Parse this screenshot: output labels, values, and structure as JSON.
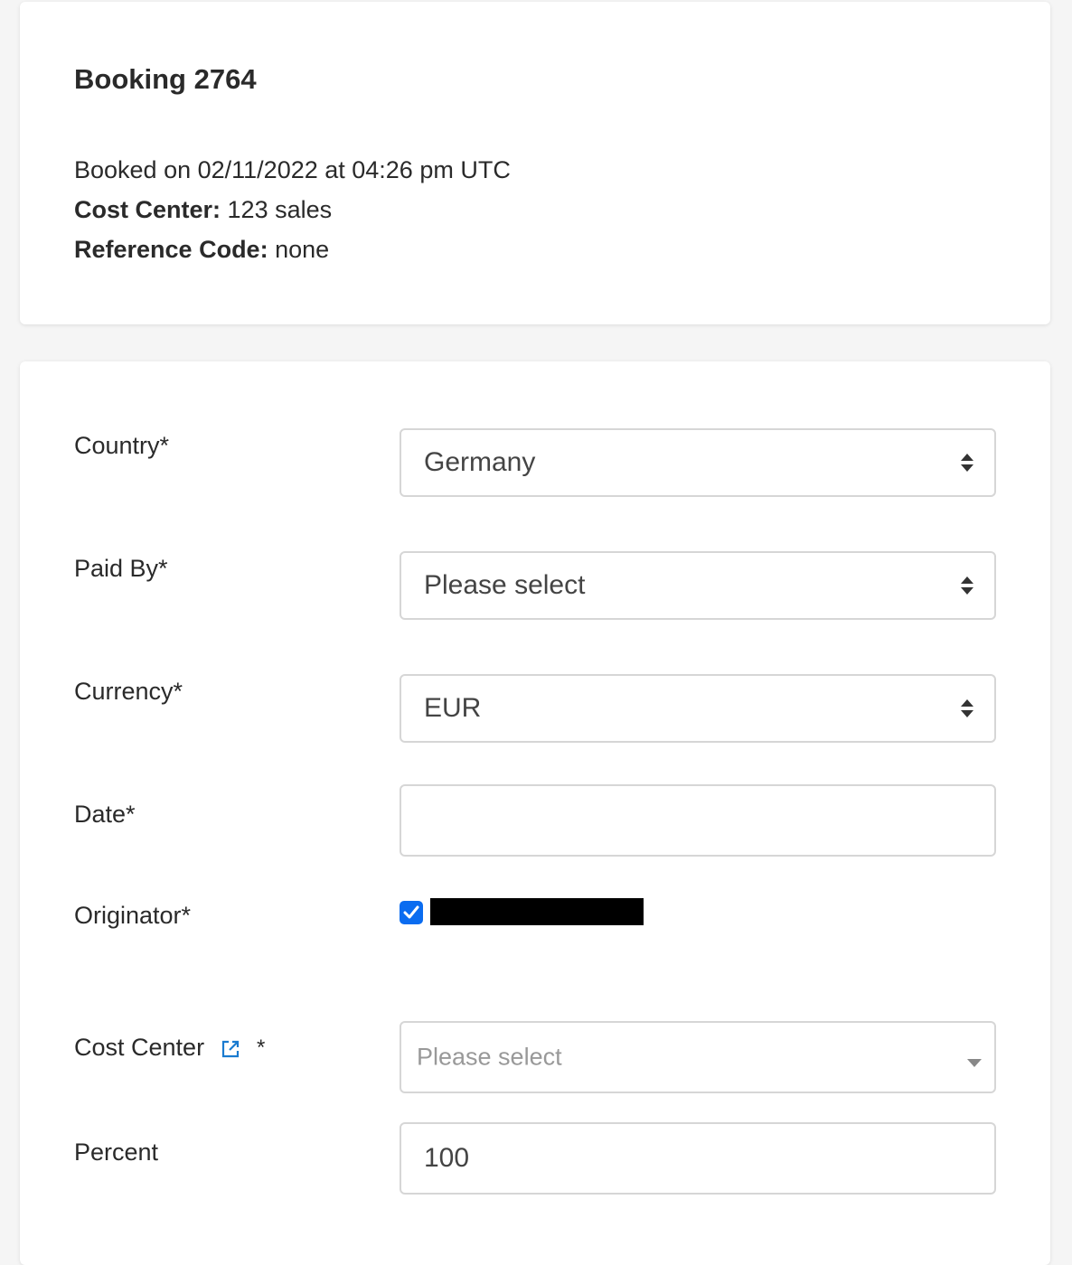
{
  "booking": {
    "title": "Booking 2764",
    "booked_on": "Booked on 02/11/2022 at 04:26 pm UTC",
    "cost_center_label": "Cost Center:",
    "cost_center_value": "123 sales",
    "reference_label": "Reference Code:",
    "reference_value": "none"
  },
  "form": {
    "country": {
      "label": "Country*",
      "value": "Germany"
    },
    "paid_by": {
      "label": "Paid By*",
      "value": "Please select"
    },
    "currency": {
      "label": "Currency*",
      "value": "EUR"
    },
    "date": {
      "label": "Date*",
      "value": ""
    },
    "originator": {
      "label": "Originator*",
      "checked": true
    },
    "cost_center": {
      "label": "Cost Center",
      "required_mark": "*",
      "placeholder": "Please select",
      "icon": "external-link-icon"
    },
    "percent": {
      "label": "Percent",
      "value": "100"
    }
  },
  "colors": {
    "checkbox": "#0a6cf0",
    "link_icon": "#1a7bd0"
  }
}
